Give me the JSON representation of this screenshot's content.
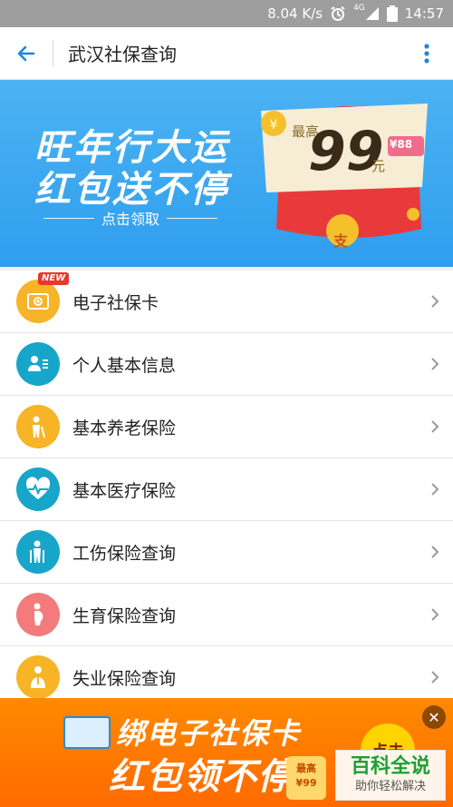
{
  "status_bar": {
    "speed": "8.04 K/s",
    "network": "4G",
    "time": "14:57"
  },
  "header": {
    "title": "武汉社保查询"
  },
  "banner": {
    "line1": "旺年行大运",
    "line2": "红包送不停",
    "cta": "点击领取",
    "max_label": "最高",
    "amount": "99",
    "unit": "元",
    "tag": "¥88",
    "coin_char": "支"
  },
  "menu": [
    {
      "label": "电子社保卡",
      "icon": "social-card-icon",
      "color": "#f6b426",
      "badge": "NEW"
    },
    {
      "label": "个人基本信息",
      "icon": "personal-info-icon",
      "color": "#17a6c9"
    },
    {
      "label": "基本养老保险",
      "icon": "elderly-icon",
      "color": "#f6b426"
    },
    {
      "label": "基本医疗保险",
      "icon": "heartbeat-icon",
      "color": "#17a6c9"
    },
    {
      "label": "工伤保险查询",
      "icon": "injury-icon",
      "color": "#17a6c9"
    },
    {
      "label": "生育保险查询",
      "icon": "pregnancy-icon",
      "color": "#f37b7b"
    },
    {
      "label": "失业保险查询",
      "icon": "unemployment-icon",
      "color": "#f6b426"
    }
  ],
  "ad": {
    "line1": "绑电子社保卡",
    "line2": "红包领不停",
    "click": "点击",
    "coin_top": "最高",
    "coin_amount": "¥99"
  },
  "watermark": {
    "brand": "百科全说",
    "slogan": "助你轻松解决"
  }
}
